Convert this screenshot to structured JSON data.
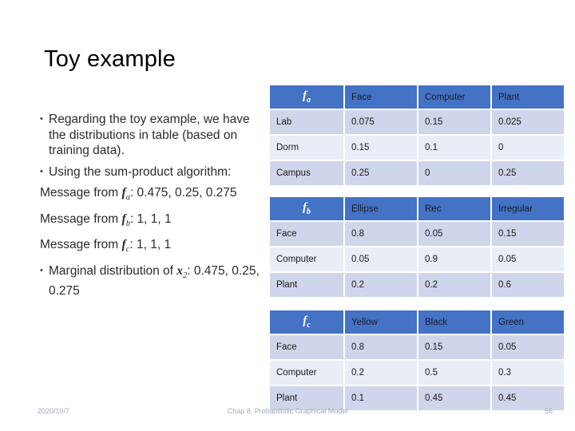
{
  "slide": {
    "title": "Toy example"
  },
  "bullets": [
    {
      "text": "Regarding the toy example, we have the distributions in table (based on training data)."
    },
    {
      "text": "Using the sum-product algorithm:"
    }
  ],
  "messages": [
    {
      "prefix": "Message from ",
      "symbol": "f",
      "subscript": "a",
      "suffix": ": 0.475, 0.25, 0.275"
    },
    {
      "prefix": "Message from ",
      "symbol": "f",
      "subscript": "b",
      "suffix": ": 1, 1, 1"
    },
    {
      "prefix": "Message from ",
      "symbol": "f",
      "subscript": "c",
      "suffix": ": 1, 1, 1"
    }
  ],
  "marginal": {
    "prefix": "Marginal distribution of ",
    "symbol": "x",
    "subscript": "2",
    "suffix": ":",
    "values": "0.475, 0.25, 0.275"
  },
  "tables": [
    {
      "id": "fa",
      "corner_symbol": "f",
      "corner_subscript": "a",
      "columns": [
        "Face",
        "Computer",
        "Plant"
      ],
      "rows": [
        {
          "label": "Lab",
          "values": [
            "0.075",
            "0.15",
            "0.025"
          ]
        },
        {
          "label": "Dorm",
          "values": [
            "0.15",
            "0.1",
            "0"
          ]
        },
        {
          "label": "Campus",
          "values": [
            "0.25",
            "0",
            "0.25"
          ]
        }
      ]
    },
    {
      "id": "fb",
      "corner_symbol": "f",
      "corner_subscript": "b",
      "columns": [
        "Ellipse",
        "Rec",
        "Irregular"
      ],
      "rows": [
        {
          "label": "Face",
          "values": [
            "0.8",
            "0.05",
            "0.15"
          ]
        },
        {
          "label": "Computer",
          "values": [
            "0.05",
            "0.9",
            "0.05"
          ]
        },
        {
          "label": "Plant",
          "values": [
            "0.2",
            "0.2",
            "0.6"
          ]
        }
      ]
    },
    {
      "id": "fc",
      "corner_symbol": "f",
      "corner_subscript": "c",
      "columns": [
        "Yellow",
        "Black",
        "Green"
      ],
      "rows": [
        {
          "label": "Face",
          "values": [
            "0.8",
            "0.15",
            "0.05"
          ]
        },
        {
          "label": "Computer",
          "values": [
            "0.2",
            "0.5",
            "0.3"
          ]
        },
        {
          "label": "Plant",
          "values": [
            "0.1",
            "0.45",
            "0.45"
          ]
        }
      ]
    }
  ],
  "footer": {
    "date": "2020/10/7",
    "center": "Chap 8. Probabilistic Graphical Model",
    "page": "56"
  },
  "colors": {
    "header_blue": "#4472C4",
    "row_odd": "#CFD5EA",
    "row_even": "#E9EDF6",
    "footer_text": "#A6A6C0",
    "title_text": "#000000"
  }
}
